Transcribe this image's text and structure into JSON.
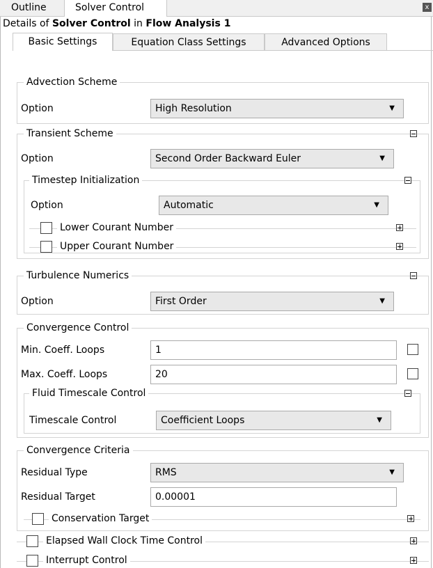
{
  "top_tabs": [
    "Outline",
    "Solver Control"
  ],
  "details": {
    "prefix": "Details of ",
    "object": "Solver Control",
    "mid": " in ",
    "parent": "Flow Analysis 1"
  },
  "sub_tabs": [
    "Basic Settings",
    "Equation Class Settings",
    "Advanced Options"
  ],
  "advection": {
    "title": "Advection Scheme",
    "option_label": "Option",
    "option_value": "High Resolution"
  },
  "transient": {
    "title": "Transient Scheme",
    "option_label": "Option",
    "option_value": "Second Order Backward Euler",
    "timestep": {
      "title": "Timestep Initialization",
      "option_label": "Option",
      "option_value": "Automatic",
      "lower": "Lower Courant Number",
      "upper": "Upper Courant Number"
    }
  },
  "turbulence": {
    "title": "Turbulence Numerics",
    "option_label": "Option",
    "option_value": "First Order"
  },
  "convergence_control": {
    "title": "Convergence Control",
    "min_label": "Min. Coeff. Loops",
    "min_value": "1",
    "max_label": "Max. Coeff. Loops",
    "max_value": "20",
    "fluid": {
      "title": "Fluid Timescale Control",
      "label": "Timescale Control",
      "value": "Coefficient Loops"
    }
  },
  "convergence_criteria": {
    "title": "Convergence Criteria",
    "type_label": "Residual Type",
    "type_value": "RMS",
    "target_label": "Residual Target",
    "target_value": "0.00001",
    "conservation": "Conservation Target"
  },
  "elapsed": "Elapsed Wall Clock Time Control",
  "interrupt": "Interrupt Control",
  "icons": {
    "dropdown": "▼",
    "close": "x"
  }
}
